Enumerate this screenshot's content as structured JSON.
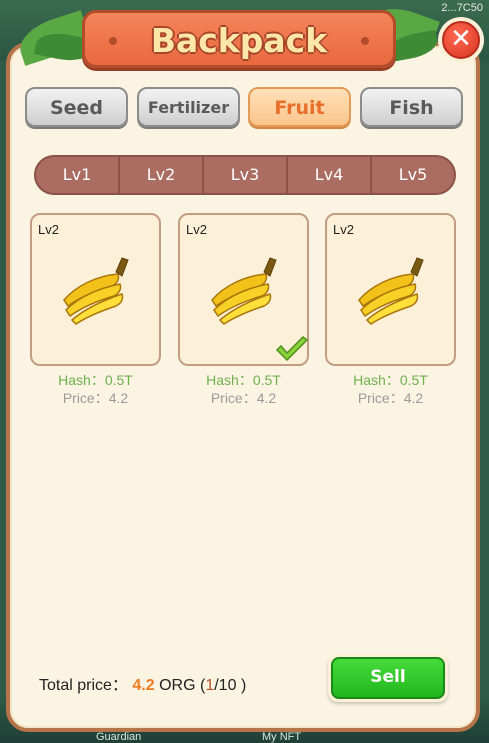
{
  "corner_id": "2...7C50",
  "bottom_labels": [
    "Guardian",
    "My NFT"
  ],
  "title": "Backpack",
  "close_icon": "close-icon",
  "tabs": [
    {
      "label": "Seed"
    },
    {
      "label": "Fertilizer"
    },
    {
      "label": "Fruit"
    },
    {
      "label": "Fish"
    }
  ],
  "active_tab": "Fruit",
  "levels": [
    "Lv1",
    "Lv2",
    "Lv3",
    "Lv4",
    "Lv5"
  ],
  "items": [
    {
      "level": "Lv2",
      "icon": "banana-icon",
      "hash": "Hash：0.5T",
      "price": "Price：4.2",
      "selected": false
    },
    {
      "level": "Lv2",
      "icon": "banana-icon",
      "hash": "Hash：0.5T",
      "price": "Price：4.2",
      "selected": true
    },
    {
      "level": "Lv2",
      "icon": "banana-icon",
      "hash": "Hash：0.5T",
      "price": "Price：4.2",
      "selected": false
    }
  ],
  "footer": {
    "total_label": "Total price：",
    "total_value": "4.2",
    "currency": "ORG",
    "count_open": "(",
    "count_selected": "1",
    "count_total": "/10",
    "count_close": ")",
    "sell_label": "Sell"
  },
  "colors": {
    "panel_bg": "#fbf4e2",
    "panel_border": "#b77349",
    "title_plank": "#e9683f",
    "active_tab_text": "#e86f2a",
    "level_bar": "#ab6d62",
    "hash_text": "#6fb04d",
    "total_value": "#f07a22",
    "sell_button": "#22b51e"
  }
}
